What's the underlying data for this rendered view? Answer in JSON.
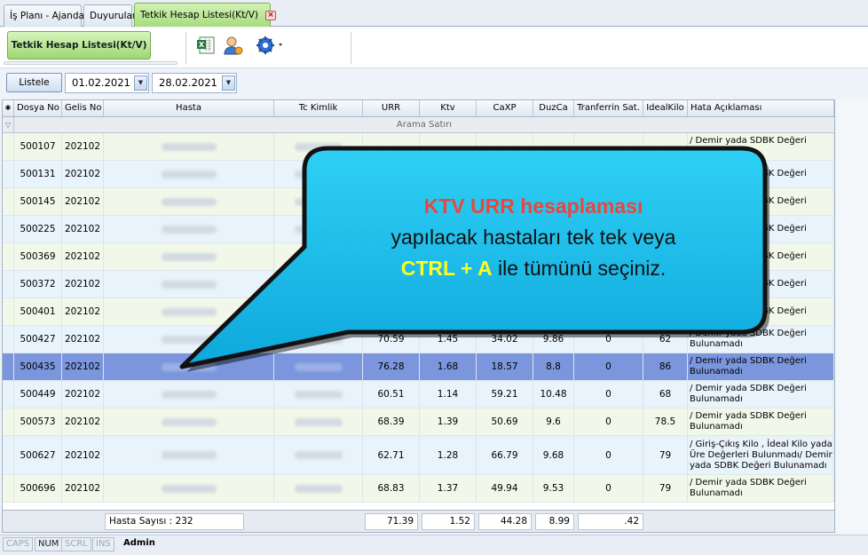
{
  "tabs": [
    {
      "label": "İş Planı - Ajanda"
    },
    {
      "label": "Duyurular"
    },
    {
      "label": "Tetkik Hesap Listesi(Kt/V)"
    }
  ],
  "toolbar": {
    "main_button": "Tetkik Hesap Listesi(Kt/V)"
  },
  "filter": {
    "list_button": "Listele",
    "date_from": "01.02.2021",
    "date_to": "28.02.2021"
  },
  "grid": {
    "columns": [
      "Dosya No",
      "Gelis No",
      "Hasta",
      "Tc Kimlik",
      "URR",
      "Ktv",
      "CaXP",
      "DuzCa",
      "Tranferrin Sat.",
      "IdealKilo",
      "Hata Açıklaması"
    ],
    "search_row": "Arama Satırı",
    "rows": [
      {
        "dosya": "500107",
        "gelis": "202102",
        "urr": "",
        "ktv": "",
        "caxp": "",
        "duzca": "",
        "tran": "",
        "ideal": "",
        "hata": "/ Demir yada SDBK Değeri Bulunamadı"
      },
      {
        "dosya": "500131",
        "gelis": "202102",
        "urr": "",
        "ktv": "",
        "caxp": "",
        "duzca": "",
        "tran": "",
        "ideal": "",
        "hata": "/ Demir yada SDBK Değeri"
      },
      {
        "dosya": "500145",
        "gelis": "202102",
        "urr": "",
        "ktv": "",
        "caxp": "",
        "duzca": "",
        "tran": "",
        "ideal": "",
        "hata": "/ Demir yada SDBK Değeri"
      },
      {
        "dosya": "500225",
        "gelis": "202102",
        "urr": "",
        "ktv": "",
        "caxp": "",
        "duzca": "",
        "tran": "",
        "ideal": "",
        "hata": "/ Demir yada SDBK Değeri"
      },
      {
        "dosya": "500369",
        "gelis": "202102",
        "urr": "",
        "ktv": "",
        "caxp": "",
        "duzca": "",
        "tran": "",
        "ideal": "",
        "hata": "/ Demir yada SDBK Değeri"
      },
      {
        "dosya": "500372",
        "gelis": "202102",
        "urr": "",
        "ktv": "",
        "caxp": "",
        "duzca": "",
        "tran": "",
        "ideal": "",
        "hata": "/ Demir yada SDBK Değeri"
      },
      {
        "dosya": "500401",
        "gelis": "202102",
        "urr": "",
        "ktv": "",
        "caxp": "",
        "duzca": "",
        "tran": "",
        "ideal": "",
        "hata": "/ Demir yada SDBK Değeri"
      },
      {
        "dosya": "500427",
        "gelis": "202102",
        "urr": "70.59",
        "ktv": "1.45",
        "caxp": "34.02",
        "duzca": "9.86",
        "tran": "0",
        "ideal": "62",
        "hata": "/ Demir yada SDBK Değeri Bulunamadı"
      },
      {
        "dosya": "500435",
        "gelis": "202102",
        "urr": "76.28",
        "ktv": "1.68",
        "caxp": "18.57",
        "duzca": "8.8",
        "tran": "0",
        "ideal": "86",
        "hata": "/ Demir yada SDBK Değeri Bulunamadı"
      },
      {
        "dosya": "500449",
        "gelis": "202102",
        "urr": "60.51",
        "ktv": "1.14",
        "caxp": "59.21",
        "duzca": "10.48",
        "tran": "0",
        "ideal": "68",
        "hata": "/ Demir yada SDBK Değeri Bulunamadı"
      },
      {
        "dosya": "500573",
        "gelis": "202102",
        "urr": "68.39",
        "ktv": "1.39",
        "caxp": "50.69",
        "duzca": "9.6",
        "tran": "0",
        "ideal": "78.5",
        "hata": "/ Demir yada SDBK Değeri Bulunamadı"
      },
      {
        "dosya": "500627",
        "gelis": "202102",
        "urr": "62.71",
        "ktv": "1.28",
        "caxp": "66.79",
        "duzca": "9.68",
        "tran": "0",
        "ideal": "79",
        "hata": "/ Giriş-Çıkış Kilo , İdeal Kilo yada Üre Değerleri Bulunmadı/ Demir yada SDBK Değeri Bulunamadı"
      },
      {
        "dosya": "500696",
        "gelis": "202102",
        "urr": "68.83",
        "ktv": "1.37",
        "caxp": "49.94",
        "duzca": "9.53",
        "tran": "0",
        "ideal": "79",
        "hata": "/ Demir yada SDBK Değeri Bulunamadı"
      }
    ],
    "footer": {
      "hasta_sayisi": "Hasta Sayısı : 232",
      "urr": "71.39",
      "ktv": "1.52",
      "caxp": "44.28",
      "duzca": "8.99",
      "tran": ".42"
    }
  },
  "status": {
    "caps": "CAPS",
    "num": "NUM",
    "scrl": "SCRL",
    "ins": "INS",
    "user": "Admin"
  },
  "callout": {
    "title": "KTV  URR hesaplaması",
    "line2": "yapılacak hastaları  tek tek veya",
    "shortcut": "CTRL + A",
    "line3_rest": " ile tümünü seçiniz."
  }
}
